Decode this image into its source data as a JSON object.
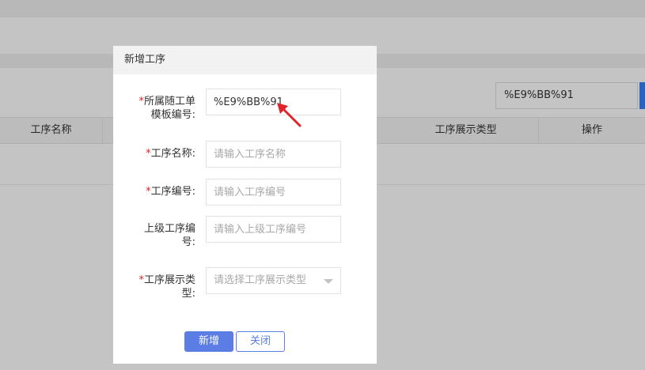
{
  "background": {
    "search_value": "%E9%BB%91",
    "table_headers": [
      "工序名称",
      "工序展示类型",
      "操作"
    ]
  },
  "dialog": {
    "title": "新增工序",
    "fields": {
      "template_no": {
        "required_mark": "*",
        "label_line1": "所属随工单",
        "label_line2": "模板编号:",
        "value": "%E9%BB%91"
      },
      "process_name": {
        "required_mark": "*",
        "label": "工序名称:",
        "placeholder": "请输入工序名称"
      },
      "process_no": {
        "required_mark": "*",
        "label": "工序编号:",
        "placeholder": "请输入工序编号"
      },
      "parent_no": {
        "label_line1": "上级工序编",
        "label_line2": "号:",
        "placeholder": "请输入上级工序编号"
      },
      "display_type": {
        "required_mark": "*",
        "label_line1": "工序展示类",
        "label_line2": "型:",
        "placeholder": "请选择工序展示类型"
      }
    },
    "buttons": {
      "add": "新增",
      "close": "关闭"
    }
  },
  "colors": {
    "primary": "#5b7de4",
    "required": "#e0242c",
    "annotation_arrow": "#e0242c"
  }
}
